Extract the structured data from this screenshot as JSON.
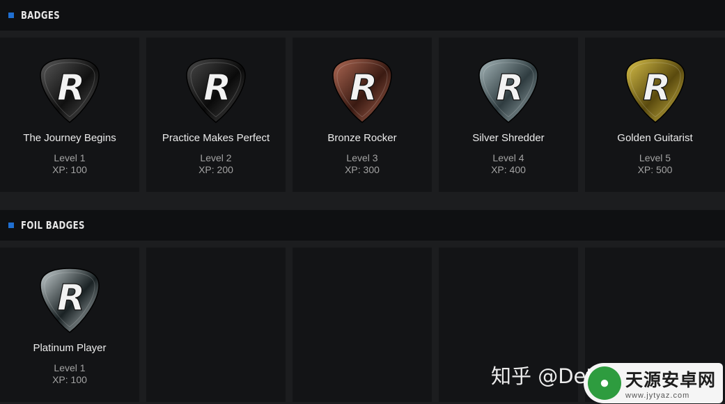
{
  "sections": {
    "badges": {
      "title": "BADGES"
    },
    "foil": {
      "title": "FOIL BADGES"
    }
  },
  "badges": [
    {
      "name": "The Journey Begins",
      "level": "Level 1",
      "xp": "XP: 100",
      "tier": "black",
      "colors": [
        "#5a5a5a",
        "#101010"
      ]
    },
    {
      "name": "Practice Makes Perfect",
      "level": "Level 2",
      "xp": "XP: 200",
      "tier": "black",
      "colors": [
        "#4a4a4a",
        "#0a0a0a"
      ]
    },
    {
      "name": "Bronze Rocker",
      "level": "Level 3",
      "xp": "XP: 300",
      "tier": "bronze",
      "colors": [
        "#b06a55",
        "#3a1a12"
      ]
    },
    {
      "name": "Silver Shredder",
      "level": "Level 4",
      "xp": "XP: 400",
      "tier": "silver",
      "colors": [
        "#a8b9bc",
        "#2f3c40"
      ]
    },
    {
      "name": "Golden Guitarist",
      "level": "Level 5",
      "xp": "XP: 500",
      "tier": "gold",
      "colors": [
        "#d9c14a",
        "#5a4a0e"
      ]
    }
  ],
  "foil_badges": [
    {
      "name": "Platinum Player",
      "level": "Level 1",
      "xp": "XP: 100",
      "tier": "platinum",
      "colors": [
        "#c9d2d4",
        "#1a2224"
      ]
    }
  ],
  "watermark": {
    "text": "知乎 @Dete",
    "logo_main": "天源安卓网",
    "logo_sub": "www.jytyaz.com"
  }
}
